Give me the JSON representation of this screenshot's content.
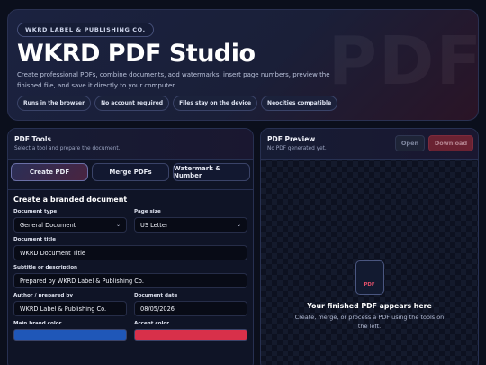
{
  "hero": {
    "eyebrow": "WKRD LABEL & PUBLISHING CO.",
    "title": "WKRD PDF Studio",
    "description": "Create professional PDFs, combine documents, add watermarks, insert page numbers, preview the finished file, and save it directly to your computer.",
    "watermark": "PDF",
    "chips": [
      "Runs in the browser",
      "No account required",
      "Files stay on the device",
      "Neocities compatible"
    ]
  },
  "tools": {
    "title": "PDF Tools",
    "subtitle": "Select a tool and prepare the document.",
    "tabs": [
      {
        "label": "Create PDF",
        "active": true
      },
      {
        "label": "Merge PDFs",
        "active": false
      },
      {
        "label": "Watermark & Number",
        "active": false
      }
    ],
    "form": {
      "heading": "Create a branded document",
      "document_type": {
        "label": "Document type",
        "value": "General Document"
      },
      "page_size": {
        "label": "Page size",
        "value": "US Letter"
      },
      "document_title": {
        "label": "Document title",
        "value": "WKRD Document Title"
      },
      "subtitle": {
        "label": "Subtitle or description",
        "value": "Prepared by WKRD Label & Publishing Co."
      },
      "author": {
        "label": "Author / prepared by",
        "value": "WKRD Label & Publishing Co."
      },
      "document_date": {
        "label": "Document date",
        "value": "08/05/2026"
      },
      "brand_color": {
        "label": "Main brand color",
        "value": "#1f57b8"
      },
      "accent_color": {
        "label": "Accent color",
        "value": "#d8304a"
      }
    }
  },
  "preview": {
    "title": "PDF Preview",
    "subtitle": "No PDF generated yet.",
    "open_label": "Open",
    "download_label": "Download",
    "icon_text": "PDF",
    "empty_title": "Your finished PDF appears here",
    "empty_desc": "Create, merge, or process a PDF using the tools on the left."
  }
}
